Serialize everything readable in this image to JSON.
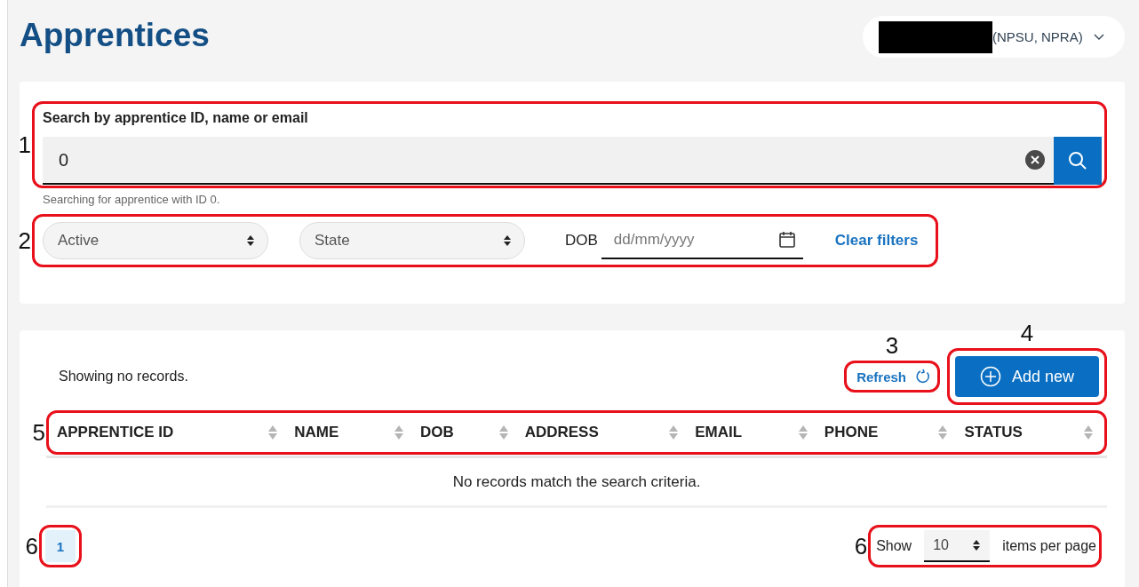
{
  "header": {
    "title": "Apprentices",
    "account": {
      "redacted": true,
      "label": "(NPSU, NPRA)"
    }
  },
  "search": {
    "annotation": "1",
    "label": "Search by apprentice ID, name or email",
    "value": "0",
    "helper": "Searching for apprentice with ID 0."
  },
  "filters": {
    "annotation": "2",
    "selects": [
      {
        "value": "Active"
      },
      {
        "value": "State"
      }
    ],
    "dob": {
      "label": "DOB",
      "placeholder": "dd/mm/yyyy"
    },
    "clear": "Clear filters"
  },
  "results": {
    "summary": "Showing no records.",
    "refresh": {
      "annotation": "3",
      "label": "Refresh"
    },
    "add": {
      "annotation": "4",
      "label": "Add new"
    },
    "table": {
      "annotation": "5",
      "columns": [
        "APPRENTICE ID",
        "NAME",
        "DOB",
        "ADDRESS",
        "EMAIL",
        "PHONE",
        "STATUS"
      ],
      "empty": "No records match the search criteria."
    },
    "pagination": {
      "annotation": "6",
      "pages": [
        {
          "label": "1",
          "selected": true
        }
      ]
    },
    "page_size": {
      "annotation": "6",
      "label": "Show",
      "value": "10",
      "suffix": "items per page"
    }
  }
}
